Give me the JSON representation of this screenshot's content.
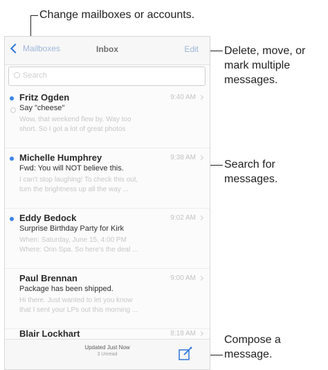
{
  "callouts": {
    "mailboxes": "Change mailboxes or accounts.",
    "edit": [
      "Delete, move, or",
      "mark multiple",
      "messages."
    ],
    "search": [
      "Search for",
      "messages."
    ],
    "compose": [
      "Compose a",
      "message."
    ]
  },
  "nav": {
    "back_label": "Mailboxes",
    "title": "Inbox",
    "edit_label": "Edit"
  },
  "search": {
    "placeholder": "Search"
  },
  "messages": [
    {
      "sender": "Fritz Ogden",
      "time": "9:40 AM",
      "subject": "Say \"cheese\"",
      "preview1": "Wow, that weekend flew by. Way too",
      "preview2": "short. So I got a lot of great photos",
      "unread": true,
      "replied": true
    },
    {
      "sender": "Michelle Humphrey",
      "time": "9:38 AM",
      "subject": "Fwd: You will NOT believe this.",
      "preview1": "I can't stop laughing! To check this out,",
      "preview2": "turn the brightness up all the way ...",
      "unread": true,
      "replied": false
    },
    {
      "sender": "Eddy Bedock",
      "time": "9:02 AM",
      "subject": "Surprise Birthday Party for Kirk",
      "preview1": "When: Saturday, June 15, 4:00 PM",
      "preview2": "Where: Orin Spa. So here's the deal ...",
      "unread": true,
      "replied": false
    },
    {
      "sender": "Paul Brennan",
      "time": "9:00 AM",
      "subject": "Package has been shipped.",
      "preview1": "Hi there. Just wanted to let you know",
      "preview2": "that I sent your LPs out this morning ...",
      "unread": false,
      "replied": false
    },
    {
      "sender": "Blair Lockhart",
      "time": "8:18 AM",
      "subject": "",
      "preview1": "",
      "preview2": "",
      "unread": false,
      "replied": false
    }
  ],
  "toolbar": {
    "updated": "Updated Just Now",
    "unread_count": "3 Unread"
  },
  "icons": {
    "back": "chevron-left-icon",
    "search": "search-icon",
    "compose": "compose-icon",
    "row": "chevron-right-icon"
  },
  "colors": {
    "accent": "#2f77d8",
    "unread_dot": "#3a83e6"
  }
}
